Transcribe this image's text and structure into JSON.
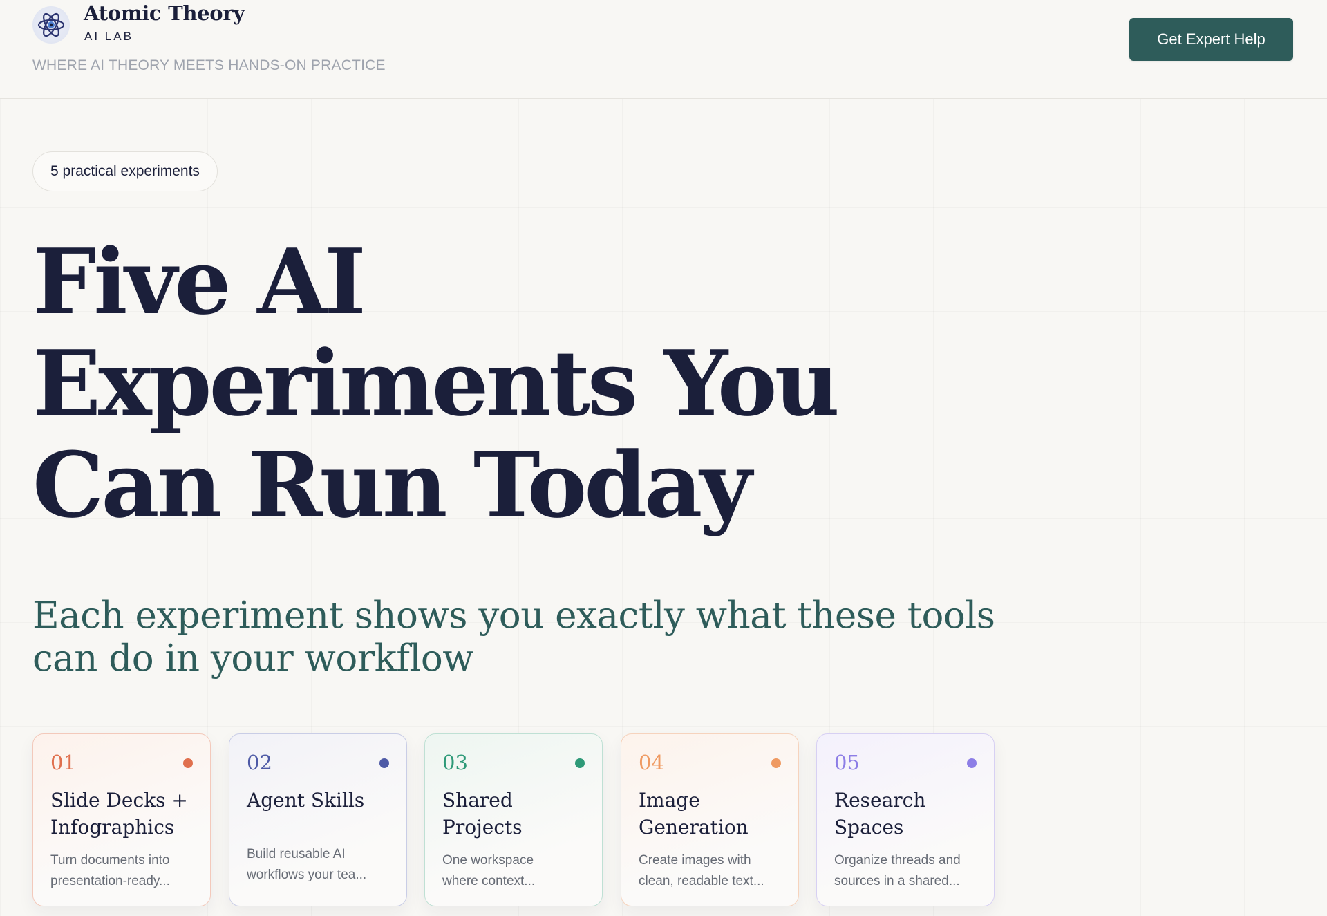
{
  "header": {
    "brand_name": "Atomic Theory",
    "brand_sub": "AI LAB",
    "tagline": "WHERE AI THEORY MEETS HANDS-ON PRACTICE",
    "cta_label": "Get Expert Help",
    "logo_icon": "atom-icon"
  },
  "hero": {
    "badge": "5 practical experiments",
    "title_lines": [
      "Five AI",
      "Experiments You",
      "Can Run Today"
    ],
    "subtitle": "Each experiment shows you exactly what these tools can do in your workflow"
  },
  "cards": [
    {
      "number": "01",
      "title": "Slide Decks + Infographics",
      "desc_lines": [
        "Turn documents into",
        "presentation-ready..."
      ],
      "accent": "#e0704e",
      "border": "#f3c9bb",
      "bg": "#fdf2ec"
    },
    {
      "number": "02",
      "title": "Agent Skills",
      "desc_lines": [
        "Build reusable AI",
        "workflows your tea..."
      ],
      "accent": "#4e5aa6",
      "border": "#c9cde6",
      "bg": "#f2f2f8"
    },
    {
      "number": "03",
      "title": "Shared Projects",
      "desc_lines": [
        "One workspace",
        "where context..."
      ],
      "accent": "#2e9a78",
      "border": "#bfe0d4",
      "bg": "#eef6f1"
    },
    {
      "number": "04",
      "title": "Image Generation",
      "desc_lines": [
        "Create images with",
        "clean, readable text..."
      ],
      "accent": "#ef9a62",
      "border": "#f6d3bd",
      "bg": "#fdf3ec"
    },
    {
      "number": "05",
      "title": "Research Spaces",
      "desc_lines": [
        "Organize threads and",
        "sources in a shared..."
      ],
      "accent": "#8d7ee6",
      "border": "#d7d0f3",
      "bg": "#f4f1fc"
    }
  ]
}
